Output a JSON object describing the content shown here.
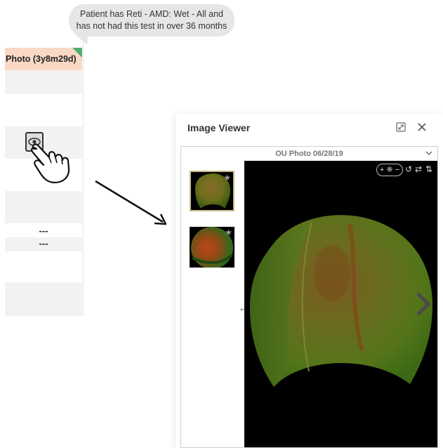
{
  "tooltip": {
    "line1": "Patient has Reti - AMD: Wet - All and",
    "line2": "has not had this test in over 36 months"
  },
  "column": {
    "header": "Photo (3y8m29d)",
    "dash1": "---",
    "dash2": "---"
  },
  "viewer": {
    "title": "Image Viewer",
    "image_header": "OU Photo 06/28/19",
    "thumbnails": [
      {
        "name": "fundus-thumb-1",
        "selected": true,
        "starred": true
      },
      {
        "name": "fundus-thumb-2",
        "selected": false,
        "starred": true
      }
    ],
    "tools": {
      "zoom_in": "+",
      "zoom_reset": "❈",
      "zoom_out": "−",
      "rotate": "↺",
      "flip_horizontal": "⇄",
      "flip_vertical": "⇅"
    }
  },
  "icons": {
    "view": "eye-icon",
    "pointer": "hand-pointer-icon",
    "annotation": "arrow-icon",
    "expand": "expand-icon",
    "close": "close-icon",
    "dropdown": "chevron-down-icon",
    "previous": "arrow-left-icon",
    "next": "chevron-right-icon",
    "favorite": "star-icon"
  },
  "colors": {
    "header_bg": "#f9d9c6",
    "corner_flag": "#4fae6d",
    "tooltip_bg": "#e6e6e6",
    "thumb_selected_border": "#c9b98a",
    "image_bg": "#000000"
  }
}
